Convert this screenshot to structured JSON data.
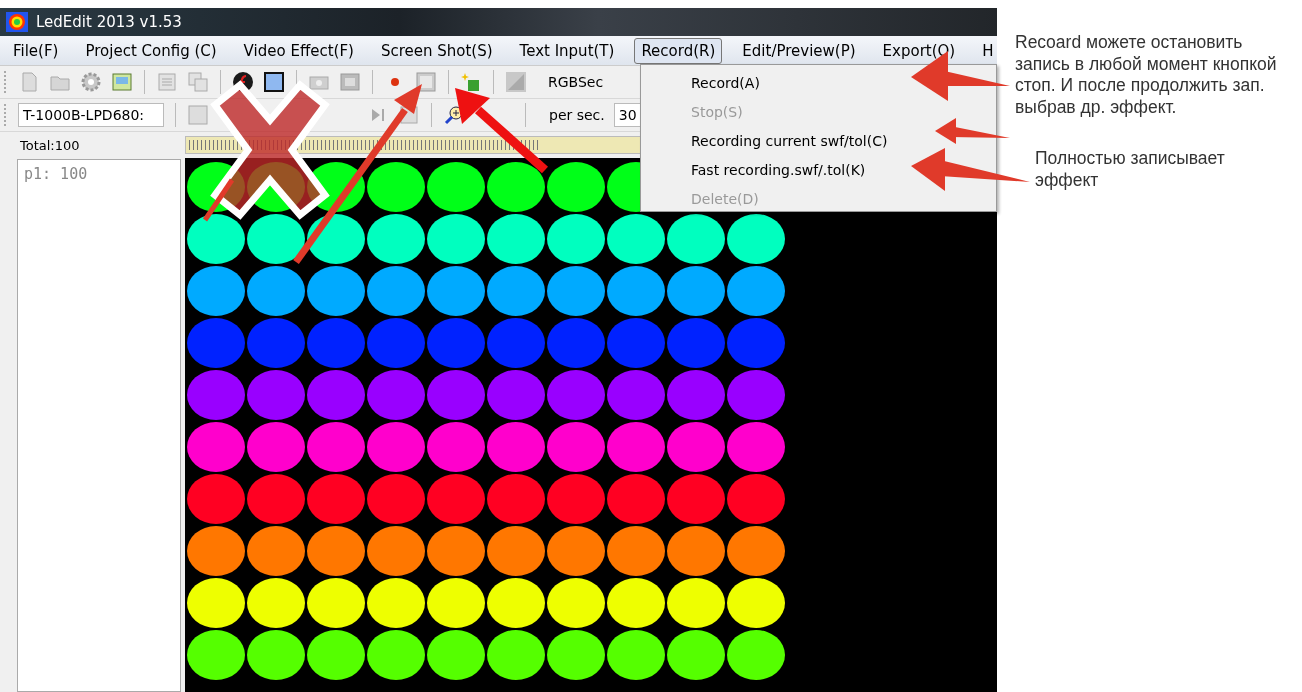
{
  "window": {
    "title": "LedEdit 2013 v1.53"
  },
  "menu_bar": [
    {
      "label": "File(F)",
      "selected": false
    },
    {
      "label": "Project Config (C)",
      "selected": false
    },
    {
      "label": "Video Effect(F)",
      "selected": false
    },
    {
      "label": "Screen Shot(S)",
      "selected": false
    },
    {
      "label": "Text Input(T)",
      "selected": false
    },
    {
      "label": "Record(R)",
      "selected": true
    },
    {
      "label": "Edit/Preview(P)",
      "selected": false
    },
    {
      "label": "Export(O)",
      "selected": false
    },
    {
      "label": "H",
      "selected": false
    }
  ],
  "toolbar": {
    "label": "RGBSec"
  },
  "controller": {
    "value": "T-1000B-LPD680:"
  },
  "speed": {
    "label": "per sec.",
    "value": "30"
  },
  "total": "Total:100",
  "points": [
    "p1: 100"
  ],
  "record_menu": [
    {
      "label": "Record(A)",
      "disabled": false
    },
    {
      "label": "Stop(S)",
      "disabled": true
    },
    {
      "label": "Recording current swf/tol(C)",
      "disabled": false
    },
    {
      "label": "Fast recording.swf/.tol(K)",
      "disabled": false
    },
    {
      "label": "Delete(D)",
      "disabled": true
    }
  ],
  "led_rows": [
    {
      "dots": [
        {
          "color": "#00ff18"
        },
        {
          "color": "#00ff18"
        },
        {
          "color": "#00ff18"
        },
        {
          "color": "#00ff18"
        },
        {
          "color": "#00ff18"
        },
        {
          "color": "#00ff18"
        },
        {
          "color": "#00ff18"
        },
        {
          "color": "#00ff18"
        }
      ]
    },
    {
      "dots": [
        {
          "color": "#00ffbf"
        },
        {
          "color": "#00ffbf"
        },
        {
          "color": "#00ffbf"
        },
        {
          "color": "#00ffbf"
        },
        {
          "color": "#00ffbf"
        },
        {
          "color": "#00ffbf"
        },
        {
          "color": "#00ffbf"
        },
        {
          "color": "#00ffbf"
        },
        {
          "color": "#00ffbf"
        },
        {
          "color": "#00ffbf"
        }
      ]
    },
    {
      "dots": [
        {
          "color": "#00aaff"
        },
        {
          "color": "#00aaff"
        },
        {
          "color": "#00aaff"
        },
        {
          "color": "#00aaff"
        },
        {
          "color": "#00aaff"
        },
        {
          "color": "#00aaff"
        },
        {
          "color": "#00aaff"
        },
        {
          "color": "#00aaff"
        },
        {
          "color": "#00aaff"
        },
        {
          "color": "#00aaff"
        }
      ]
    },
    {
      "dots": [
        {
          "color": "#0022ff"
        },
        {
          "color": "#0022ff"
        },
        {
          "color": "#0022ff"
        },
        {
          "color": "#0022ff"
        },
        {
          "color": "#0022ff"
        },
        {
          "color": "#0022ff"
        },
        {
          "color": "#0022ff"
        },
        {
          "color": "#0022ff"
        },
        {
          "color": "#0022ff"
        },
        {
          "color": "#0022ff"
        }
      ]
    },
    {
      "dots": [
        {
          "color": "#9900ff"
        },
        {
          "color": "#9900ff"
        },
        {
          "color": "#9900ff"
        },
        {
          "color": "#9900ff"
        },
        {
          "color": "#9900ff"
        },
        {
          "color": "#9900ff"
        },
        {
          "color": "#9900ff"
        },
        {
          "color": "#9900ff"
        },
        {
          "color": "#9900ff"
        },
        {
          "color": "#9900ff"
        }
      ]
    },
    {
      "dots": [
        {
          "color": "#ff00cc"
        },
        {
          "color": "#ff00cc"
        },
        {
          "color": "#ff00cc"
        },
        {
          "color": "#ff00cc"
        },
        {
          "color": "#ff00cc"
        },
        {
          "color": "#ff00cc"
        },
        {
          "color": "#ff00cc"
        },
        {
          "color": "#ff00cc"
        },
        {
          "color": "#ff00cc"
        },
        {
          "color": "#ff00cc"
        }
      ]
    },
    {
      "dots": [
        {
          "color": "#ff0022"
        },
        {
          "color": "#ff0022"
        },
        {
          "color": "#ff0022"
        },
        {
          "color": "#ff0022"
        },
        {
          "color": "#ff0022"
        },
        {
          "color": "#ff0022"
        },
        {
          "color": "#ff0022"
        },
        {
          "color": "#ff0022"
        },
        {
          "color": "#ff0022"
        },
        {
          "color": "#ff0022"
        }
      ]
    },
    {
      "dots": [
        {
          "color": "#ff7700"
        },
        {
          "color": "#ff7700"
        },
        {
          "color": "#ff7700"
        },
        {
          "color": "#ff7700"
        },
        {
          "color": "#ff7700"
        },
        {
          "color": "#ff7700"
        },
        {
          "color": "#ff7700"
        },
        {
          "color": "#ff7700"
        },
        {
          "color": "#ff7700"
        },
        {
          "color": "#ff7700"
        }
      ]
    },
    {
      "dots": [
        {
          "color": "#eeff00"
        },
        {
          "color": "#eeff00"
        },
        {
          "color": "#eeff00"
        },
        {
          "color": "#eeff00"
        },
        {
          "color": "#eeff00"
        },
        {
          "color": "#eeff00"
        },
        {
          "color": "#eeff00"
        },
        {
          "color": "#eeff00"
        },
        {
          "color": "#eeff00"
        },
        {
          "color": "#eeff00"
        }
      ]
    },
    {
      "dots": [
        {
          "color": "#55ff00"
        },
        {
          "color": "#55ff00"
        },
        {
          "color": "#55ff00"
        },
        {
          "color": "#55ff00"
        },
        {
          "color": "#55ff00"
        },
        {
          "color": "#55ff00"
        },
        {
          "color": "#55ff00"
        },
        {
          "color": "#55ff00"
        },
        {
          "color": "#55ff00"
        },
        {
          "color": "#55ff00"
        }
      ]
    }
  ],
  "annotations": [
    "Recoard можете остановить запись в любой момент кнопкой стоп. И после продолжить зап. выбрав др. эффект.",
    "Полностью записывает эффект"
  ]
}
